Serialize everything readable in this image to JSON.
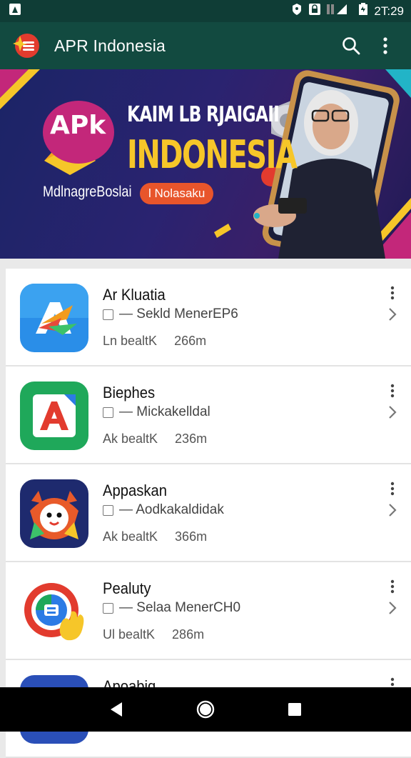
{
  "status_bar": {
    "time": "2T:29",
    "left_icon": "notification-icon",
    "right_icons": [
      "vpn-key-icon",
      "lock-icon",
      "signal-icon",
      "battery-icon"
    ]
  },
  "app_bar": {
    "title": "APR Indonesia",
    "logo_icon": "flag-menu-logo-icon",
    "search_icon": "search-icon",
    "more_icon": "more-vert-icon"
  },
  "banner": {
    "badge_text": "APk",
    "headline_line1": "KAIM LB RJAIGAII",
    "headline_line2": "INDONESIA",
    "subtitle": "MdlnagreBoslai",
    "pill_text": "l Nolasaku",
    "colors": {
      "background": "#1f2468",
      "accent_yellow": "#f6c629",
      "accent_orange": "#e8552b",
      "accent_magenta": "#c3277a"
    }
  },
  "list": {
    "items": [
      {
        "name": "Ar Kluatia",
        "subtitle": "— Sekld MenerEP6",
        "meta_label": "Ln bealtK",
        "size": "266m",
        "icon": "app-store-a-icon"
      },
      {
        "name": "Biephes",
        "subtitle": "— Mickakelldal",
        "meta_label": "Ak bealtK",
        "size": "236m",
        "icon": "red-a-app-icon"
      },
      {
        "name": "Appaskan",
        "subtitle": "— Aodkakaldidak",
        "meta_label": "Ak bealtK",
        "size": "366m",
        "icon": "fox-face-app-icon"
      },
      {
        "name": "Pealuty",
        "subtitle": "— Selaa MenerCH0",
        "meta_label": "Ul bealtK",
        "size": "286m",
        "icon": "ring-hand-app-icon"
      },
      {
        "name": "Apoabiq",
        "subtitle": "",
        "meta_label": "",
        "size": "",
        "icon": "play-app-icon"
      }
    ]
  },
  "nav_bar": {
    "back_icon": "back-triangle-icon",
    "home_icon": "home-circle-icon",
    "recents_icon": "recents-square-icon"
  }
}
